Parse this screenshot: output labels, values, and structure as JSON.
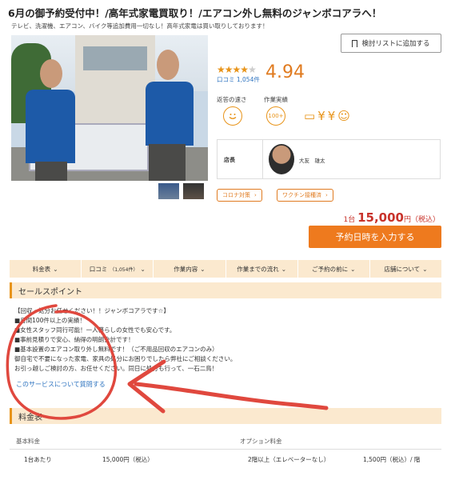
{
  "page": {
    "title": "6月の御予約受付中！/高年式家電買取り！/エアコン外し無料のジャンボコアラへ！",
    "subtitle": "テレビ、洗濯機、エアコン、バイク等追加費用一切なし！高年式家電は買い取りしております！"
  },
  "bookmark": {
    "label": "検討リストに追加する",
    "icon": "bookmark-icon"
  },
  "rating": {
    "stars": 4,
    "stars_total": 5,
    "score": "4.94",
    "reviews": "口コミ 1,054件"
  },
  "features": {
    "response_label": "返答の速さ",
    "record_label": "作業実績",
    "record_badge": "100+",
    "payment_icons": [
      "credit-card-icon",
      "yen-transfer-icon",
      "yen-cash-icon",
      "group-icon"
    ]
  },
  "staff": {
    "label": "店長",
    "name": "大友　雄太"
  },
  "tags": [
    {
      "label": "コロナ対策"
    },
    {
      "label": "ワクチン接種済"
    }
  ],
  "price": {
    "prefix": "1台",
    "amount": "15,000",
    "suffix": "円（税込）"
  },
  "cta": {
    "label": "予約日時を入力する"
  },
  "tabs": [
    {
      "label": "料金表",
      "sub": ""
    },
    {
      "label": "口コミ",
      "sub": "（1,054件）"
    },
    {
      "label": "作業内容",
      "sub": ""
    },
    {
      "label": "作業までの流れ",
      "sub": ""
    },
    {
      "label": "ご予約の前に",
      "sub": ""
    },
    {
      "label": "店舗について",
      "sub": ""
    }
  ],
  "selling_points": {
    "heading": "セールスポイント",
    "lines": [
      "【回収・処分お任せください！！ジャンボコアラです☆】",
      "■月間100件以上の実績！",
      "■女性スタッフ同行可能！一人暮らしの女性でも安心です。",
      "■事前見積りで安心、納得の明朗会計です！",
      "■基本設置のエアコン取り外し無料です！（ご不用品回収のエアコンのみ）",
      "御自宅で不要になった家電、家具の処分にお困りでしたら弊社にご相談ください。",
      "お引っ越しご検討の方、お任せください。同日に処分も行って、一石二鳥！"
    ],
    "question_link": "このサービスについて質問する"
  },
  "price_table": {
    "heading": "料金表",
    "basic_label": "基本料金",
    "option_label": "オプション料金",
    "basic_item": "1台あたり",
    "basic_price": "15,000円（税込）",
    "option_item": "2階以上（エレベーターなし）",
    "option_price": "1,500円（税込）/ 階"
  },
  "colors": {
    "accent": "#ee7a1e",
    "star": "#e8941a",
    "price": "#c8322a",
    "link": "#2f74c0",
    "tab_bg": "#fbe9cf",
    "annotation": "#e0483e"
  }
}
